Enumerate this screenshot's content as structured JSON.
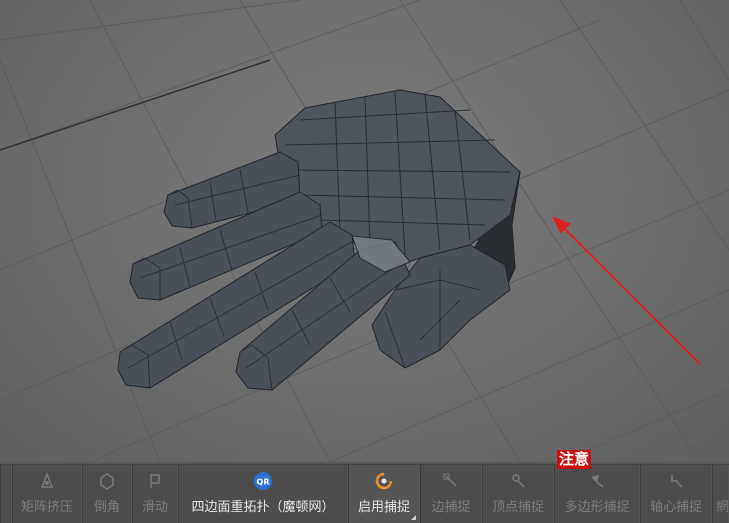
{
  "toolbar": {
    "items": [
      {
        "label": "",
        "icon": "partial-icon"
      },
      {
        "label": "矩阵挤压",
        "icon": "matrix-extrude-icon"
      },
      {
        "label": "倒角",
        "icon": "bevel-icon"
      },
      {
        "label": "滑动",
        "icon": "slide-icon"
      },
      {
        "label": "四边面重拓扑（魔顿网）",
        "icon": "qr-remesh-icon",
        "icon_text": "QR"
      },
      {
        "label": "启用捕捉",
        "icon": "snap-enable-icon"
      },
      {
        "label": "边捕捉",
        "icon": "edge-snap-icon"
      },
      {
        "label": "顶点捕捉",
        "icon": "vertex-snap-icon"
      },
      {
        "label": "多边形捕捉",
        "icon": "polygon-snap-icon"
      },
      {
        "label": "轴心捕捉",
        "icon": "pivot-snap-icon"
      },
      {
        "label": "網",
        "icon": "partial-icon"
      }
    ]
  },
  "annotation": {
    "note": "注意",
    "arrow_color": "#e02020"
  },
  "colors": {
    "mesh": "#4a5058",
    "wire": "#22262b",
    "grid": "#5b5b5b",
    "toolbar": "#4d4d4d"
  }
}
